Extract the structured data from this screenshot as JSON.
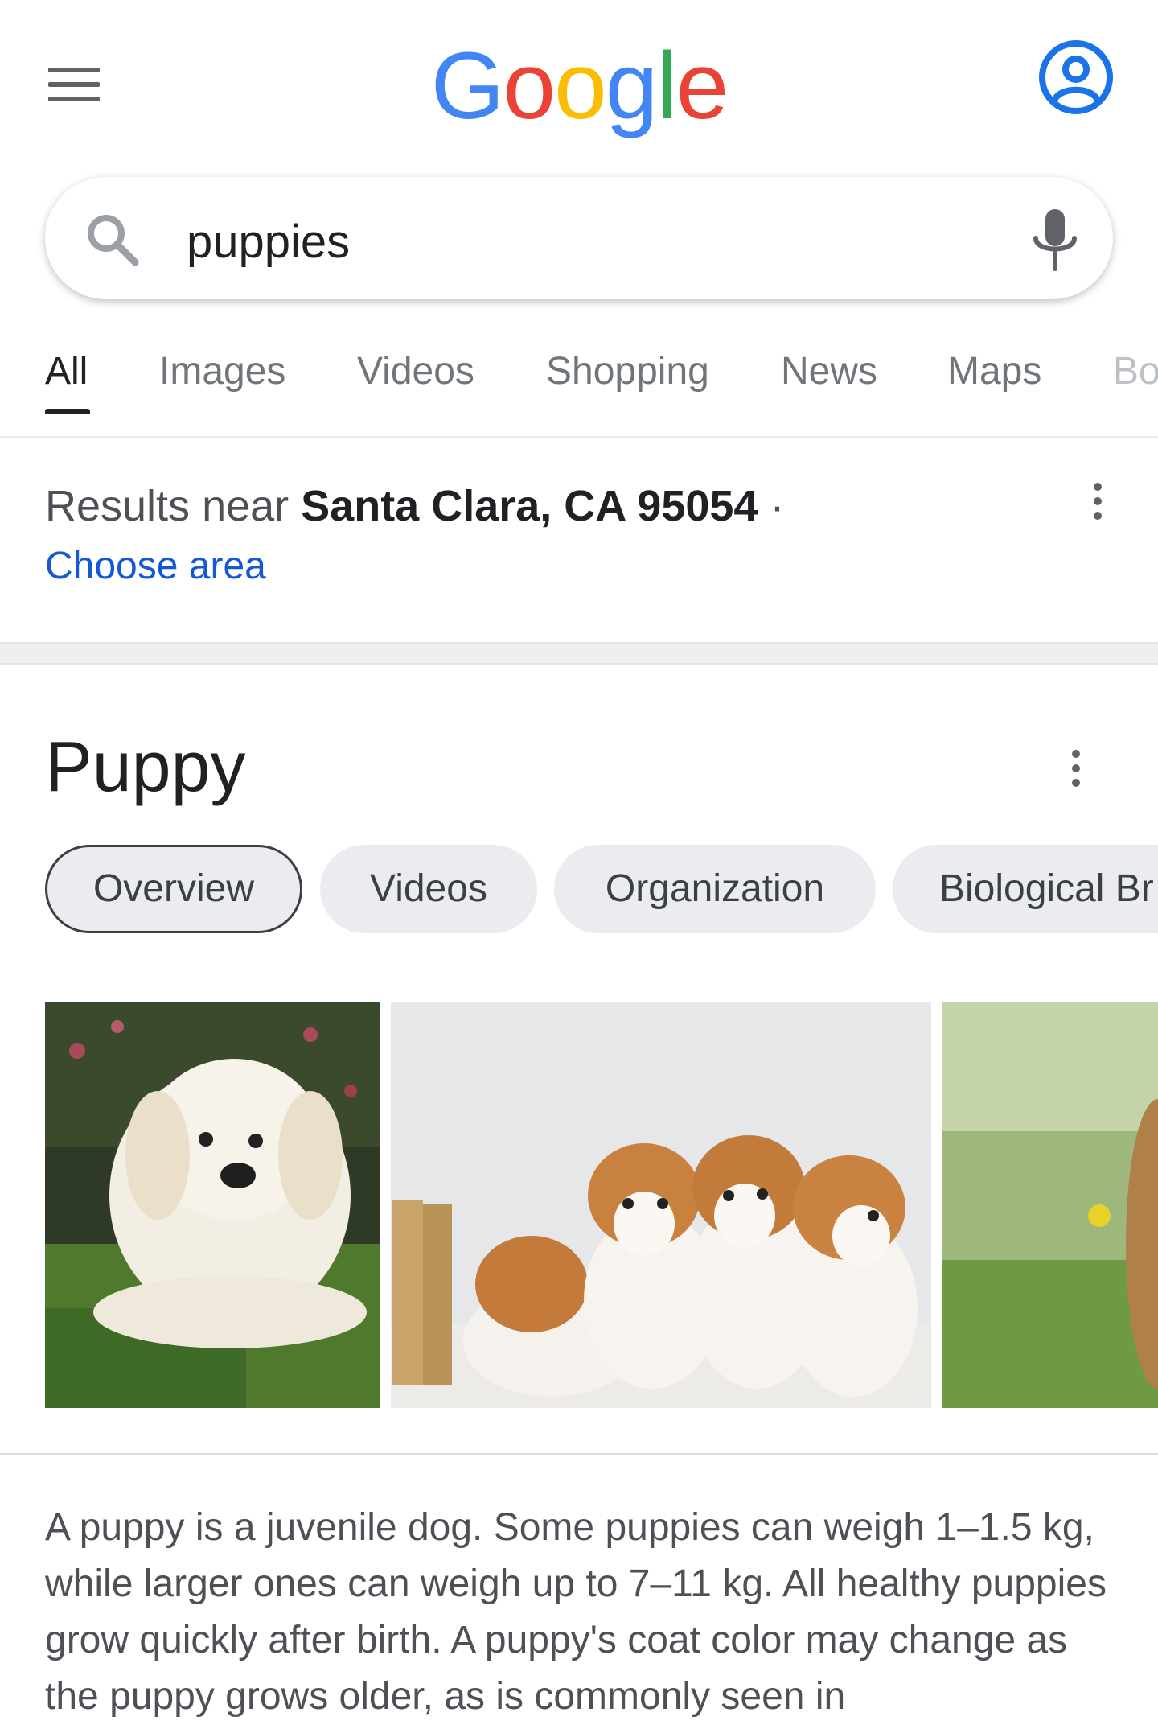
{
  "header": {
    "logo_letters": [
      "G",
      "o",
      "o",
      "g",
      "l",
      "e"
    ],
    "logo_colors": [
      "#4285F4",
      "#EA4335",
      "#FBBC05",
      "#4285F4",
      "#34A853",
      "#EA4335"
    ]
  },
  "search": {
    "query": "puppies"
  },
  "tabs": [
    {
      "label": "All",
      "active": true
    },
    {
      "label": "Images"
    },
    {
      "label": "Videos"
    },
    {
      "label": "Shopping"
    },
    {
      "label": "News"
    },
    {
      "label": "Maps"
    },
    {
      "label": "Bo"
    }
  ],
  "location": {
    "prefix": "Results near ",
    "place": "Santa Clara, CA 95054",
    "suffix": " ·",
    "choose_area": "Choose area"
  },
  "knowledge_panel": {
    "title": "Puppy",
    "chips": [
      {
        "label": "Overview",
        "selected": true
      },
      {
        "label": "Videos"
      },
      {
        "label": "Organization"
      },
      {
        "label": "Biological Br"
      }
    ],
    "description": "A puppy is a juvenile dog. Some puppies can weigh 1–1.5 kg, while larger ones can weigh up to 7–11 kg. All healthy puppies grow quickly after birth. A puppy's coat color may change as the puppy grows older, as is commonly seen in"
  },
  "colors": {
    "accent_blue": "#1a73e8",
    "link_blue": "#1558d6",
    "text_dark": "#202124",
    "text_muted": "#70757a"
  }
}
